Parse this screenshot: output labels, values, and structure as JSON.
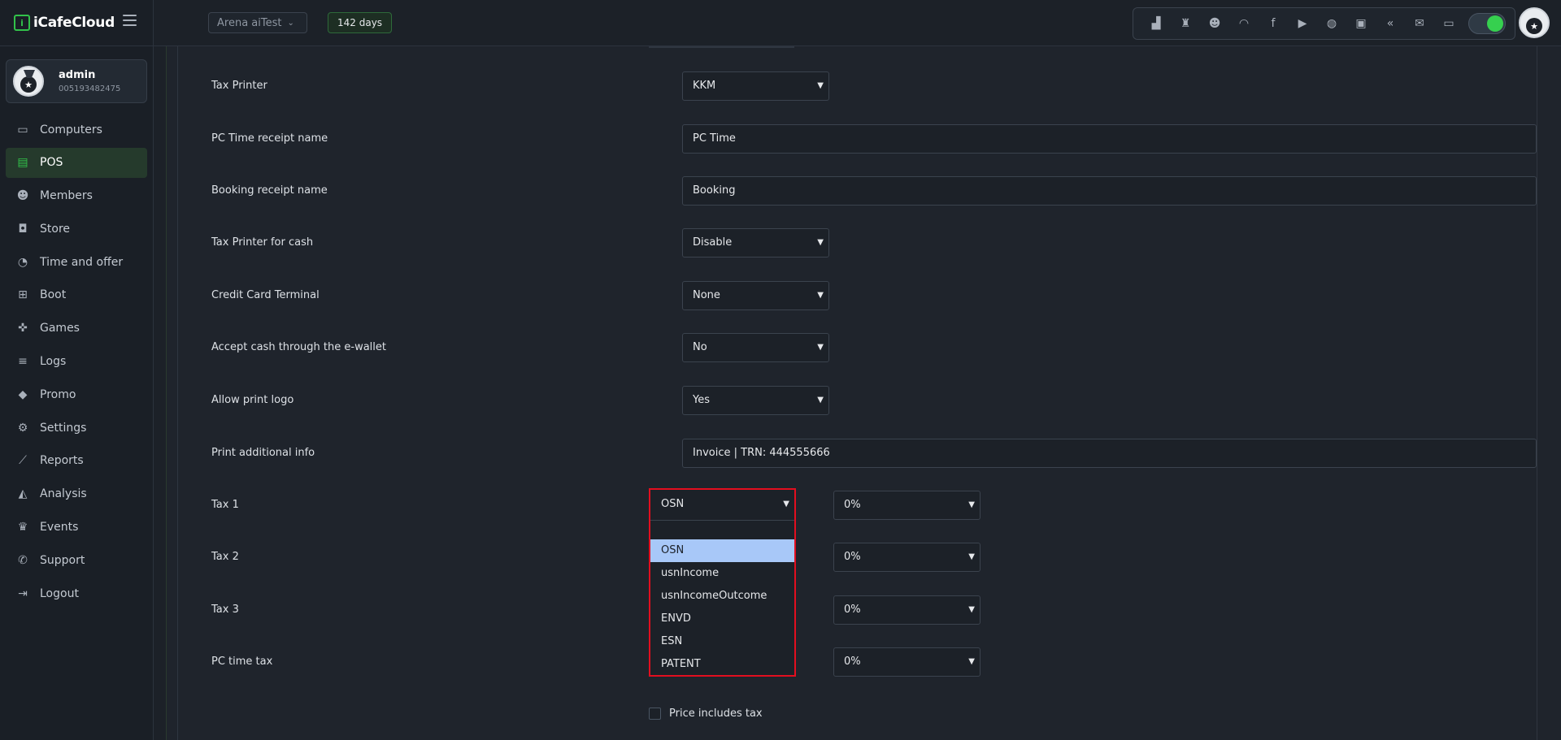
{
  "app": {
    "logo_text": "iCafeCloud",
    "logo_accent": "#32c24a"
  },
  "user": {
    "name": "admin",
    "id": "005193482475"
  },
  "nav": [
    {
      "key": "computers",
      "label": "Computers",
      "icon": "monitor-icon"
    },
    {
      "key": "pos",
      "label": "POS",
      "icon": "cash-register-icon",
      "active": true
    },
    {
      "key": "members",
      "label": "Members",
      "icon": "users-icon"
    },
    {
      "key": "store",
      "label": "Store",
      "icon": "bag-icon"
    },
    {
      "key": "time-and-offer",
      "label": "Time and offer",
      "icon": "stopwatch-icon"
    },
    {
      "key": "boot",
      "label": "Boot",
      "icon": "windows-icon"
    },
    {
      "key": "games",
      "label": "Games",
      "icon": "gamepad-icon"
    },
    {
      "key": "logs",
      "label": "Logs",
      "icon": "list-icon"
    },
    {
      "key": "promo",
      "label": "Promo",
      "icon": "tag-icon"
    },
    {
      "key": "settings",
      "label": "Settings",
      "icon": "gear-icon"
    },
    {
      "key": "reports",
      "label": "Reports",
      "icon": "line-chart-icon"
    },
    {
      "key": "analysis",
      "label": "Analysis",
      "icon": "area-chart-icon"
    },
    {
      "key": "events",
      "label": "Events",
      "icon": "crown-icon"
    },
    {
      "key": "support",
      "label": "Support",
      "icon": "phone-icon"
    },
    {
      "key": "logout",
      "label": "Logout",
      "icon": "logout-icon"
    }
  ],
  "topbar": {
    "store": "Arena aiTest",
    "days": "142 days",
    "icons": [
      "podium-icon",
      "trophy-icon",
      "group-icon",
      "rss-icon",
      "facebook-icon",
      "youtube-icon",
      "globe-icon",
      "icafe-icon",
      "double-chevron-icon",
      "mail-icon",
      "chat-icon"
    ],
    "toggle_on": true
  },
  "form": {
    "tax_printer": {
      "label": "Tax Printer",
      "value": "KKM"
    },
    "pc_time_receipt": {
      "label": "PC Time receipt name",
      "value": "PC Time"
    },
    "booking_receipt": {
      "label": "Booking receipt name",
      "value": "Booking"
    },
    "tax_printer_cash": {
      "label": "Tax Printer for cash",
      "value": "Disable"
    },
    "credit_card_terminal": {
      "label": "Credit Card Terminal",
      "value": "None"
    },
    "accept_cash_ewallet": {
      "label": "Accept cash through the e-wallet",
      "value": "No"
    },
    "allow_print_logo": {
      "label": "Allow print logo",
      "value": "Yes"
    },
    "print_additional_info": {
      "label": "Print additional info",
      "value": "Invoice | TRN: 444555666"
    },
    "tax1": {
      "label": "Tax 1",
      "value": "OSN",
      "percent": "0%"
    },
    "tax2": {
      "label": "Tax 2",
      "percent": "0%"
    },
    "tax3": {
      "label": "Tax 3",
      "percent": "0%"
    },
    "pc_time_tax": {
      "label": "PC time tax",
      "percent": "0%"
    },
    "price_includes_tax": {
      "label": "Price includes tax",
      "checked": false
    }
  },
  "tax1_dropdown": {
    "options": [
      "OSN",
      "usnIncome",
      "usnIncomeOutcome",
      "ENVD",
      "ESN",
      "PATENT"
    ],
    "highlighted": "OSN"
  }
}
